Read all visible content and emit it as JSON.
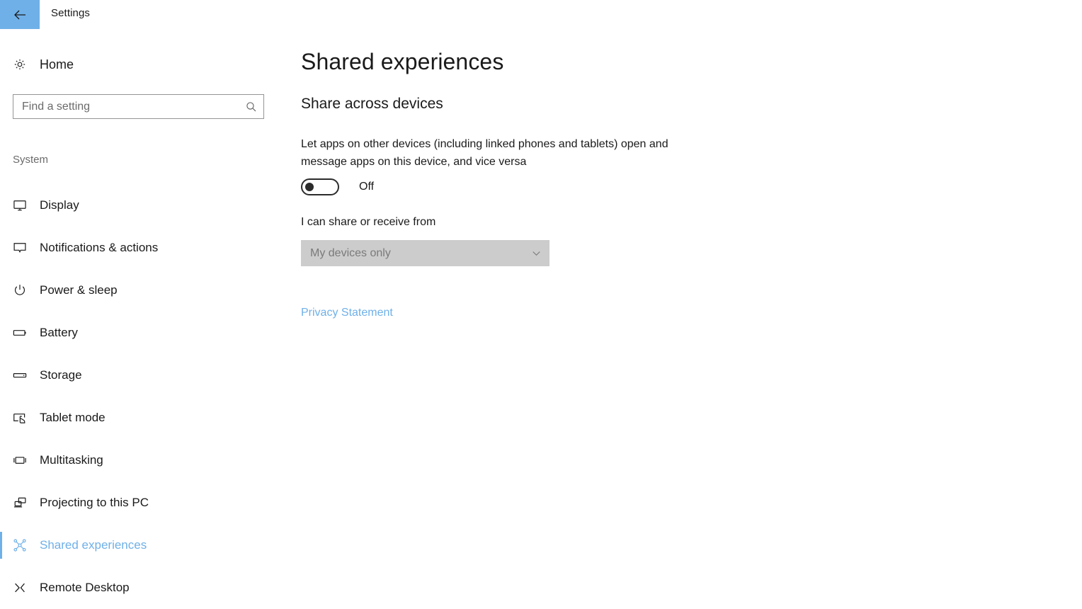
{
  "window": {
    "app_title": "Settings",
    "back_icon": "back-arrow-icon"
  },
  "sidebar": {
    "home": {
      "label": "Home",
      "icon": "gear-icon"
    },
    "search": {
      "value": "",
      "placeholder": "Find a setting",
      "icon": "search-icon"
    },
    "group_label": "System",
    "items": [
      {
        "label": "Display",
        "icon": "monitor-icon",
        "selected": false
      },
      {
        "label": "Notifications & actions",
        "icon": "notification-bubble-icon",
        "selected": false
      },
      {
        "label": "Power & sleep",
        "icon": "power-icon",
        "selected": false
      },
      {
        "label": "Battery",
        "icon": "battery-icon",
        "selected": false
      },
      {
        "label": "Storage",
        "icon": "storage-drive-icon",
        "selected": false
      },
      {
        "label": "Tablet mode",
        "icon": "tablet-hand-icon",
        "selected": false
      },
      {
        "label": "Multitasking",
        "icon": "multitasking-icon",
        "selected": false
      },
      {
        "label": "Projecting to this PC",
        "icon": "projecting-screens-icon",
        "selected": false
      },
      {
        "label": "Shared experiences",
        "icon": "shared-nodes-icon",
        "selected": true
      },
      {
        "label": "Remote Desktop",
        "icon": "remote-desktop-icon",
        "selected": false
      }
    ]
  },
  "main": {
    "page_title": "Shared experiences",
    "section_heading": "Share across devices",
    "description": "Let apps on other devices (including linked phones and tablets) open and message apps on this device, and vice versa",
    "toggle": {
      "state_label": "Off",
      "checked": false
    },
    "share_from": {
      "label": "I can share or receive from",
      "selected_value": "My devices only",
      "chevron_icon": "chevron-down-icon",
      "disabled": true
    },
    "privacy_link": "Privacy Statement"
  },
  "colors": {
    "accent": "#6fb0e8",
    "text": "#1a1a1a",
    "muted_text": "#6b6b6b",
    "disabled_bg": "#cccccc",
    "disabled_text": "#7a7a7a"
  }
}
